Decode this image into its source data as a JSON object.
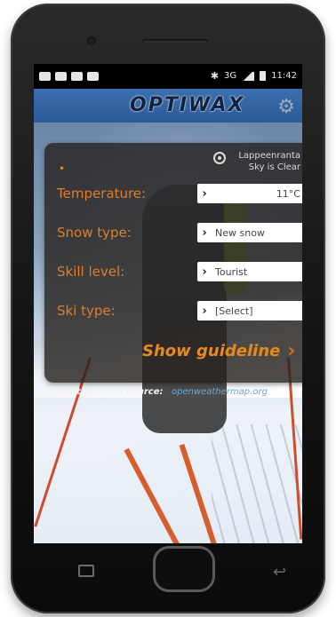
{
  "status_bar": {
    "time": "11:42",
    "network": "3G",
    "bluetooth_icon": "bluetooth-icon"
  },
  "app": {
    "title": "OPTIWAX",
    "settings_icon": "gear-icon"
  },
  "location": {
    "name": "Lappeenranta",
    "condition": "Sky is Clear"
  },
  "form": {
    "fields": [
      {
        "label": "Temperature:",
        "value": "11°C"
      },
      {
        "label": "Snow type:",
        "value": "New snow"
      },
      {
        "label": "Skill level:",
        "value": "Tourist"
      },
      {
        "label": "Ski type:",
        "value": "[Select]"
      }
    ],
    "chevron": "›"
  },
  "guideline_button": {
    "label": "Show guideline",
    "chevron": "›"
  },
  "source": {
    "label": "Weather data source:",
    "link": "openweathermap.org"
  },
  "colors": {
    "accent": "#e17c28",
    "panel": "#26221e",
    "titlebar": "#2f619e",
    "link": "#6aa6e0"
  }
}
